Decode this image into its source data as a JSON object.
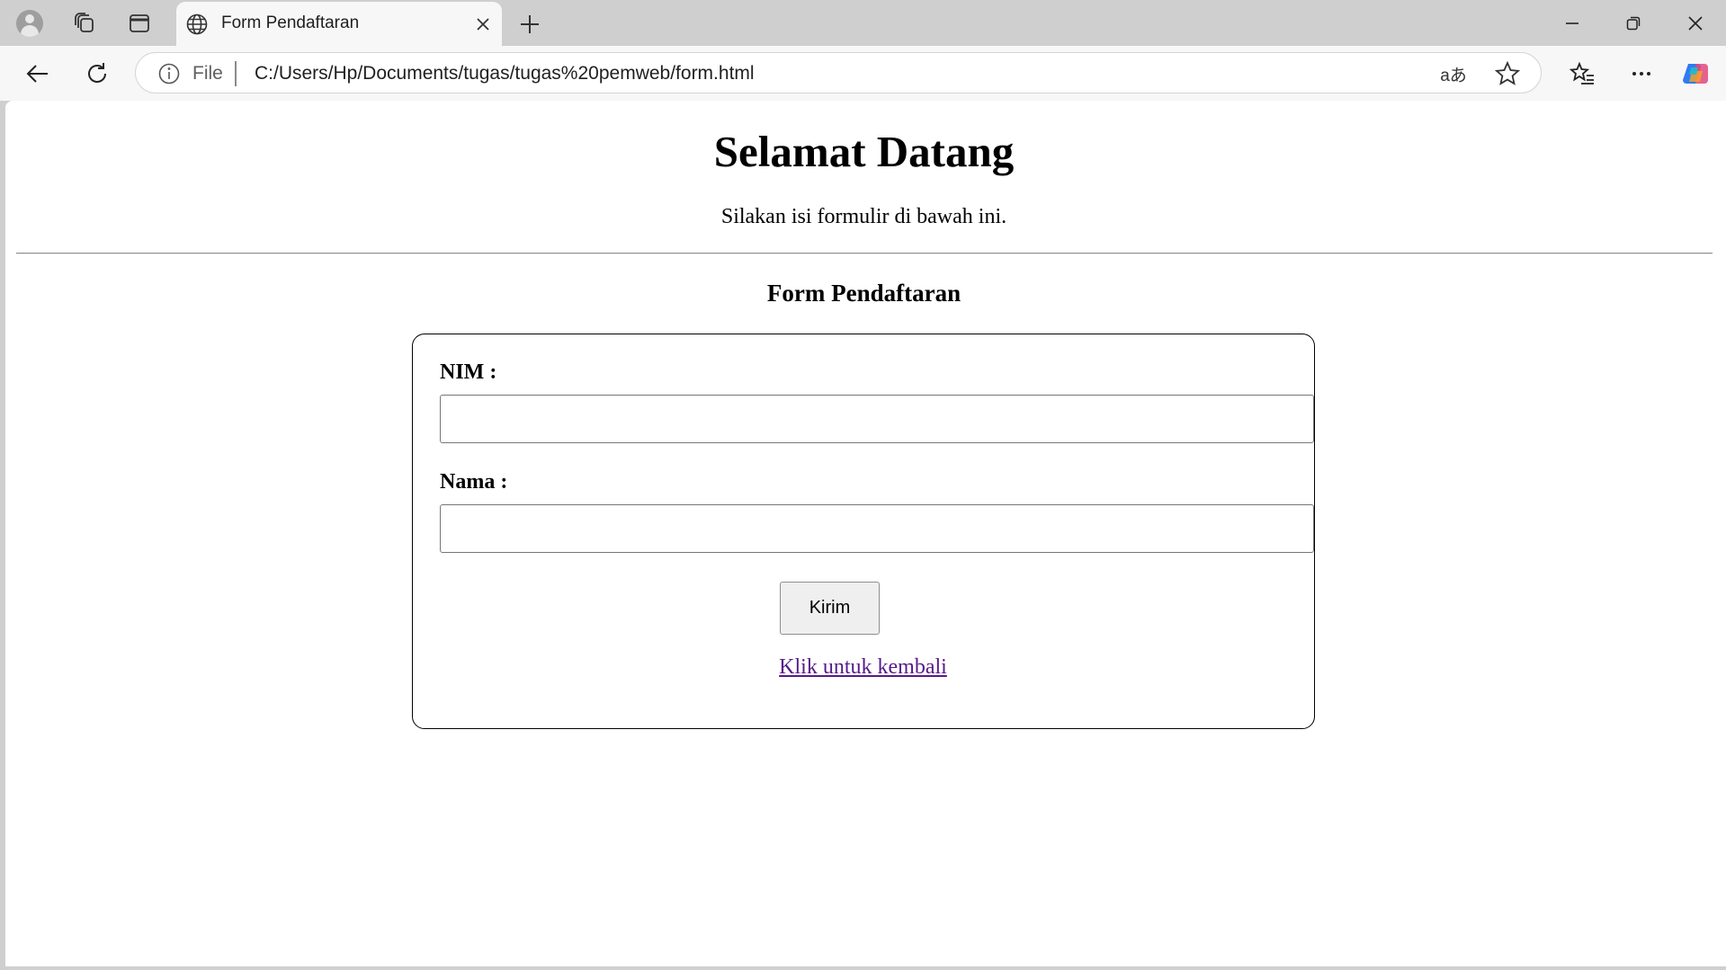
{
  "browser": {
    "tab": {
      "title": "Form Pendaftaran"
    },
    "address_bar": {
      "scheme_label": "File",
      "url": "C:/Users/Hp/Documents/tugas/tugas%20pemweb/form.html",
      "translate_glyph": "aあ"
    },
    "icons": {
      "profile": "profile-avatar-icon",
      "workspaces": "workspaces-icon",
      "vertical_tabs": "vertical-tabs-icon",
      "site": "globe-icon",
      "close_tab": "close-icon",
      "new_tab": "plus-icon",
      "minimize": "minimize-icon",
      "restore": "restore-icon",
      "close_window": "close-window-icon",
      "back": "back-arrow-icon",
      "refresh": "refresh-icon",
      "info": "info-icon",
      "favorite": "star-icon",
      "favorites_list": "favorites-icon",
      "menu": "more-icon",
      "copilot": "copilot-icon"
    }
  },
  "page": {
    "heading": "Selamat Datang",
    "subtitle": "Silakan isi formulir di bawah ini.",
    "form_title": "Form Pendaftaran",
    "form": {
      "nim_label": "NIM :",
      "nim_value": "",
      "nama_label": "Nama :",
      "nama_value": "",
      "submit_label": "Kirim",
      "back_link": "Klik untuk kembali"
    }
  },
  "colors": {
    "chrome_bg": "#cfcfcf",
    "toolbar_bg": "#f7f7f7",
    "visited_link": "#551a8b"
  }
}
